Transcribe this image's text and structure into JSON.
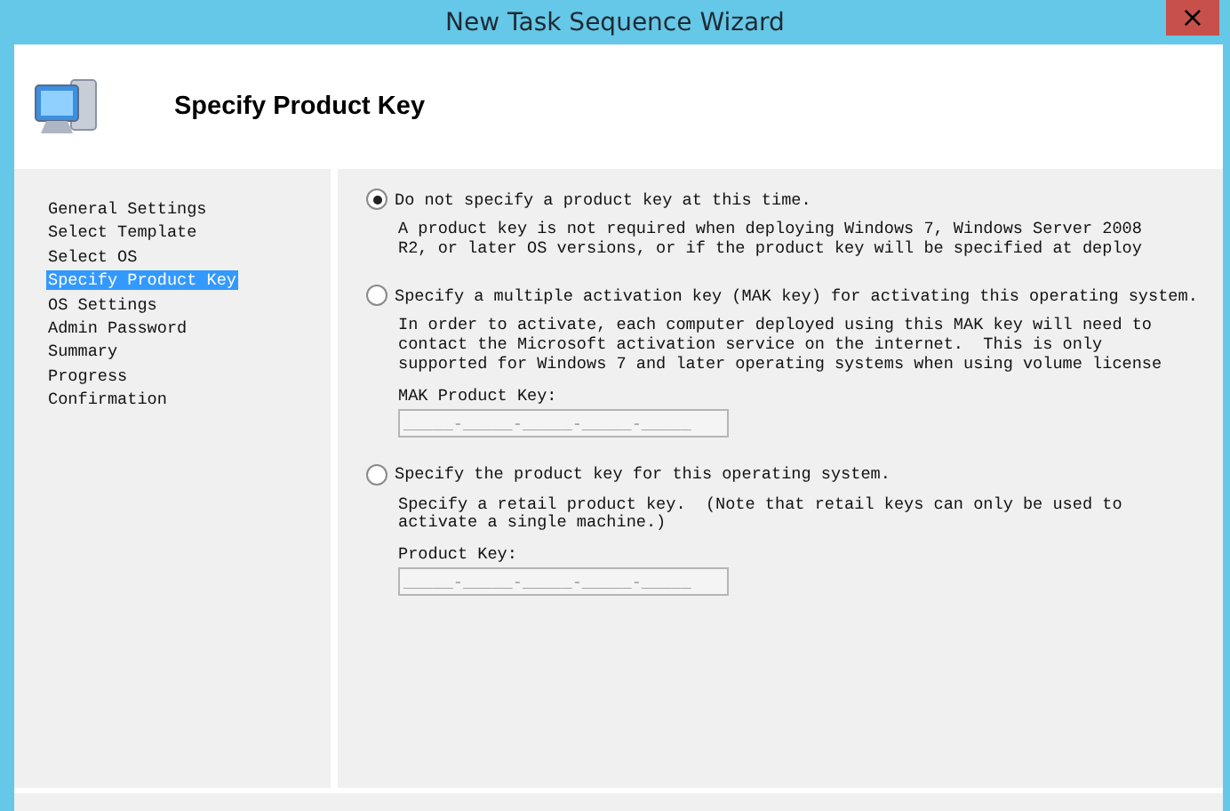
{
  "window": {
    "title": "New Task Sequence Wizard",
    "close": "×"
  },
  "header": {
    "title": "Specify Product Key"
  },
  "steps": [
    {
      "label": "General Settings",
      "selected": false
    },
    {
      "label": "Select Template",
      "selected": false
    },
    {
      "label": "Select OS",
      "selected": false
    },
    {
      "label": "Specify Product Key",
      "selected": true
    },
    {
      "label": "OS Settings",
      "selected": false
    },
    {
      "label": "Admin Password",
      "selected": false
    },
    {
      "label": "Summary",
      "selected": false
    },
    {
      "label": "Progress",
      "selected": false
    },
    {
      "label": "Confirmation",
      "selected": false
    }
  ],
  "options": [
    {
      "label": "Do not specify a product key at this time.",
      "selected": true,
      "description": "A product key is not required when deploying Windows 7, Windows Server 2008\nR2, or later OS versions, or if the product key will be specified at deploy"
    },
    {
      "label": "Specify a multiple activation key (MAK key) for activating this operating system.",
      "selected": false,
      "description": "In order to activate, each computer deployed using this MAK key will need to\ncontact the Microsoft activation service on the internet.  This is only\nsupported for Windows 7 and later operating systems when using volume license",
      "field": {
        "label": "MAK Product Key:",
        "value": "_____-_____-_____-_____-_____"
      }
    },
    {
      "label": "Specify the product key for this operating system.",
      "selected": false,
      "description": "Specify a retail product key.  (Note that retail keys can only be used to\nactivate a single machine.)",
      "field": {
        "label": "Product Key:",
        "value": "_____-_____-_____-_____-_____"
      }
    }
  ]
}
